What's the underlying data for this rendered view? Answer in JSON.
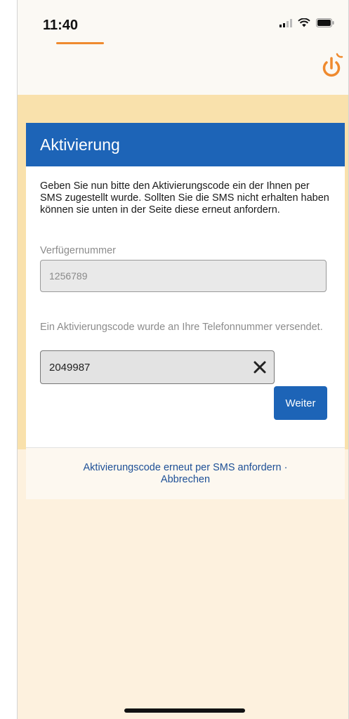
{
  "status_bar": {
    "time": "11:40"
  },
  "header": {
    "logout_icon": "power-icon",
    "accent_color": "#ef8a2e"
  },
  "card": {
    "title": "Aktivierung",
    "intro": "Geben Sie nun bitte den Aktivierungscode ein der Ihnen per SMS zugestellt wurde. Sollten Sie die SMS nicht erhalten haben können sie unten in der Seite diese erneut anfordern.",
    "account_label": "Verfügernummer",
    "account_value": "1256789",
    "code_label": "Ein Aktivierungscode wurde an Ihre Telefonnummer versendet.",
    "code_value": "2049987",
    "submit_label": "Weiter",
    "primary_color": "#1d64b7"
  },
  "footer": {
    "resend_link": "Aktivierungscode erneut per SMS anfordern",
    "separator": " ·",
    "cancel_link": "Abbrechen"
  }
}
